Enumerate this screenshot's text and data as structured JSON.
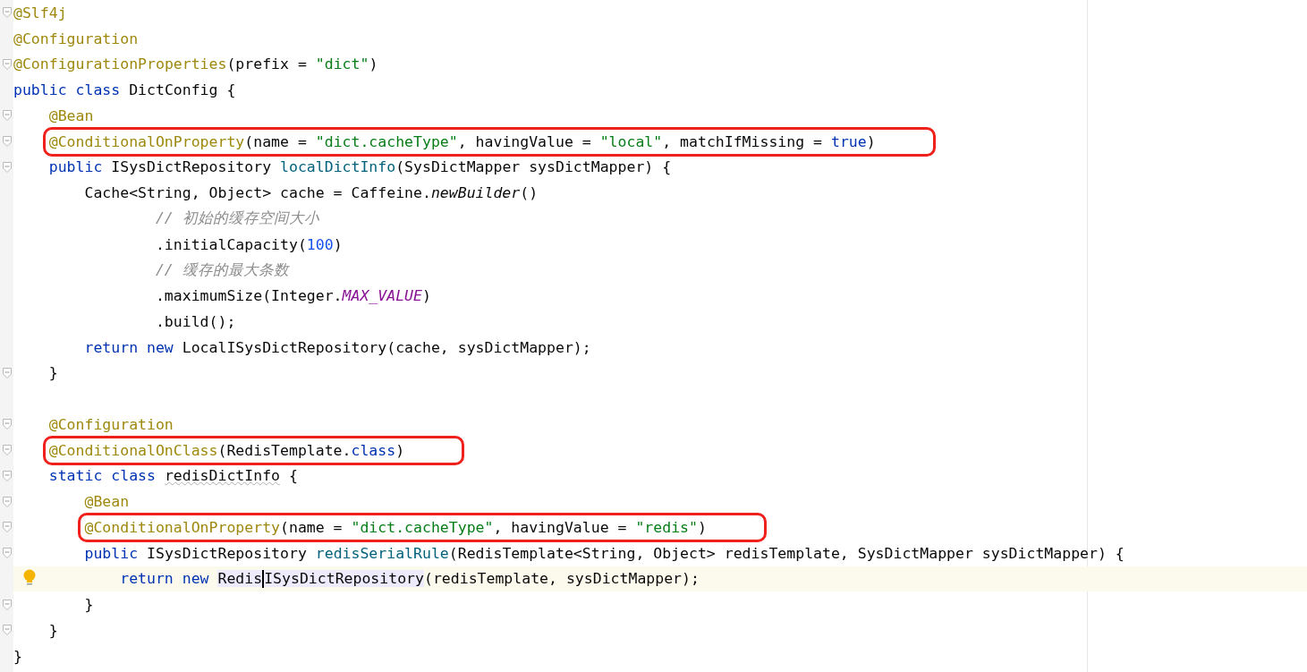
{
  "editor": {
    "lines": [
      {
        "fold": true,
        "tokens": [
          {
            "text": "@Slf4j",
            "kind": "annotation"
          }
        ]
      },
      {
        "fold": false,
        "tokens": [
          {
            "text": "@Configuration",
            "kind": "annotation"
          }
        ]
      },
      {
        "fold": true,
        "tokens": [
          {
            "text": "@ConfigurationProperties",
            "kind": "annotation"
          },
          {
            "text": "(prefix = ",
            "kind": "plain"
          },
          {
            "text": "\"dict\"",
            "kind": "string"
          },
          {
            "text": ")",
            "kind": "plain"
          }
        ]
      },
      {
        "fold": false,
        "tokens": [
          {
            "text": "public class ",
            "kind": "keyword"
          },
          {
            "text": "DictConfig {",
            "kind": "plain"
          }
        ],
        "children": [
          {
            "fold": true,
            "tokens": [
              {
                "text": "@Bean",
                "kind": "annotation"
              }
            ]
          },
          {
            "fold": true,
            "boxed": true,
            "tokens": [
              {
                "text": "@ConditionalOnProperty",
                "kind": "annotation"
              },
              {
                "text": "(name = ",
                "kind": "plain"
              },
              {
                "text": "\"dict.cacheType\"",
                "kind": "string"
              },
              {
                "text": ", havingValue = ",
                "kind": "plain"
              },
              {
                "text": "\"local\"",
                "kind": "string"
              },
              {
                "text": ", matchIfMissing = ",
                "kind": "plain"
              },
              {
                "text": "true",
                "kind": "keyword"
              },
              {
                "text": ")",
                "kind": "plain"
              }
            ]
          },
          {
            "fold": true,
            "tokens": [
              {
                "text": "public ",
                "kind": "keyword"
              },
              {
                "text": "ISysDictRepository ",
                "kind": "plain"
              },
              {
                "text": "localDictInfo",
                "kind": "method"
              },
              {
                "text": "(SysDictMapper sysDictMapper) {",
                "kind": "plain"
              }
            ],
            "children": [
              {
                "fold": false,
                "tokens": [
                  {
                    "text": "Cache<String, Object> cache = Caffeine.",
                    "kind": "plain"
                  },
                  {
                    "text": "newBuilder",
                    "kind": "static"
                  },
                  {
                    "text": "()",
                    "kind": "plain"
                  }
                ],
                "children": [
                  {
                    "fold": false,
                    "kind": "continuation",
                    "tokens": [
                      {
                        "text": "// 初始的缓存空间大小",
                        "kind": "comment"
                      }
                    ]
                  },
                  {
                    "fold": false,
                    "kind": "continuation",
                    "tokens": [
                      {
                        "text": ".initialCapacity(",
                        "kind": "plain"
                      },
                      {
                        "text": "100",
                        "kind": "number"
                      },
                      {
                        "text": ")",
                        "kind": "plain"
                      }
                    ]
                  },
                  {
                    "fold": false,
                    "kind": "continuation",
                    "tokens": [
                      {
                        "text": "// 缓存的最大条数",
                        "kind": "comment"
                      }
                    ]
                  },
                  {
                    "fold": false,
                    "kind": "continuation",
                    "tokens": [
                      {
                        "text": ".maximumSize(Integer.",
                        "kind": "plain"
                      },
                      {
                        "text": "MAX_VALUE",
                        "kind": "constant"
                      },
                      {
                        "text": ")",
                        "kind": "plain"
                      }
                    ]
                  },
                  {
                    "fold": false,
                    "kind": "continuation",
                    "tokens": [
                      {
                        "text": ".build();",
                        "kind": "plain"
                      }
                    ]
                  }
                ]
              },
              {
                "fold": false,
                "tokens": [
                  {
                    "text": "return new ",
                    "kind": "keyword"
                  },
                  {
                    "text": "LocalISysDictRepository(cache, sysDictMapper);",
                    "kind": "plain"
                  }
                ]
              }
            ]
          },
          {
            "fold": true,
            "tokens": [
              {
                "text": "}",
                "kind": "plain"
              }
            ]
          },
          {
            "fold": false
          },
          {
            "fold": true,
            "tokens": [
              {
                "text": "@Configuration",
                "kind": "annotation"
              }
            ]
          },
          {
            "fold": true,
            "boxed": true,
            "tokens": [
              {
                "text": "@ConditionalOnClass",
                "kind": "annotation"
              },
              {
                "text": "(RedisTemplate.",
                "kind": "plain"
              },
              {
                "text": "class",
                "kind": "keyword"
              },
              {
                "text": ")",
                "kind": "plain"
              }
            ]
          },
          {
            "fold": true,
            "tokens": [
              {
                "text": "static class ",
                "kind": "keyword"
              },
              {
                "text": "redisDictInfo",
                "kind": "warning"
              },
              {
                "text": " {",
                "kind": "plain"
              }
            ],
            "children": [
              {
                "fold": true,
                "tokens": [
                  {
                    "text": "@Bean",
                    "kind": "annotation"
                  }
                ]
              },
              {
                "fold": true,
                "boxed": true,
                "tokens": [
                  {
                    "text": "@ConditionalOnProperty",
                    "kind": "annotation"
                  },
                  {
                    "text": "(name = ",
                    "kind": "plain"
                  },
                  {
                    "text": "\"dict.cacheType\"",
                    "kind": "string"
                  },
                  {
                    "text": ", havingValue = ",
                    "kind": "plain"
                  },
                  {
                    "text": "\"redis\"",
                    "kind": "string"
                  },
                  {
                    "text": ")",
                    "kind": "plain"
                  }
                ]
              },
              {
                "fold": true,
                "tokens": [
                  {
                    "text": "public ",
                    "kind": "keyword"
                  },
                  {
                    "text": "ISysDictRepository ",
                    "kind": "plain"
                  },
                  {
                    "text": "redisSerialRule",
                    "kind": "method"
                  },
                  {
                    "text": "(RedisTemplate<String, Object> redisTemplate, SysDictMapper sysDictMapper) {",
                    "kind": "plain"
                  }
                ],
                "children": [
                  {
                    "fold": false,
                    "current": true,
                    "bulb": true,
                    "tokens": [
                      {
                        "text": "return new ",
                        "kind": "keyword"
                      },
                      {
                        "text": "Redis",
                        "kind": "usage",
                        "caret": true
                      },
                      {
                        "text": "ISysDictRepository",
                        "kind": "usage"
                      },
                      {
                        "text": "(redisTemplate, sysDictMapper);",
                        "kind": "plain"
                      }
                    ]
                  }
                ]
              },
              {
                "fold": true,
                "tokens": [
                  {
                    "text": "}",
                    "kind": "plain"
                  }
                ]
              }
            ]
          },
          {
            "fold": true,
            "tokens": [
              {
                "text": "}",
                "kind": "plain"
              }
            ]
          }
        ]
      },
      {
        "fold": false,
        "tokens": [
          {
            "text": "}",
            "kind": "plain"
          }
        ]
      }
    ]
  }
}
